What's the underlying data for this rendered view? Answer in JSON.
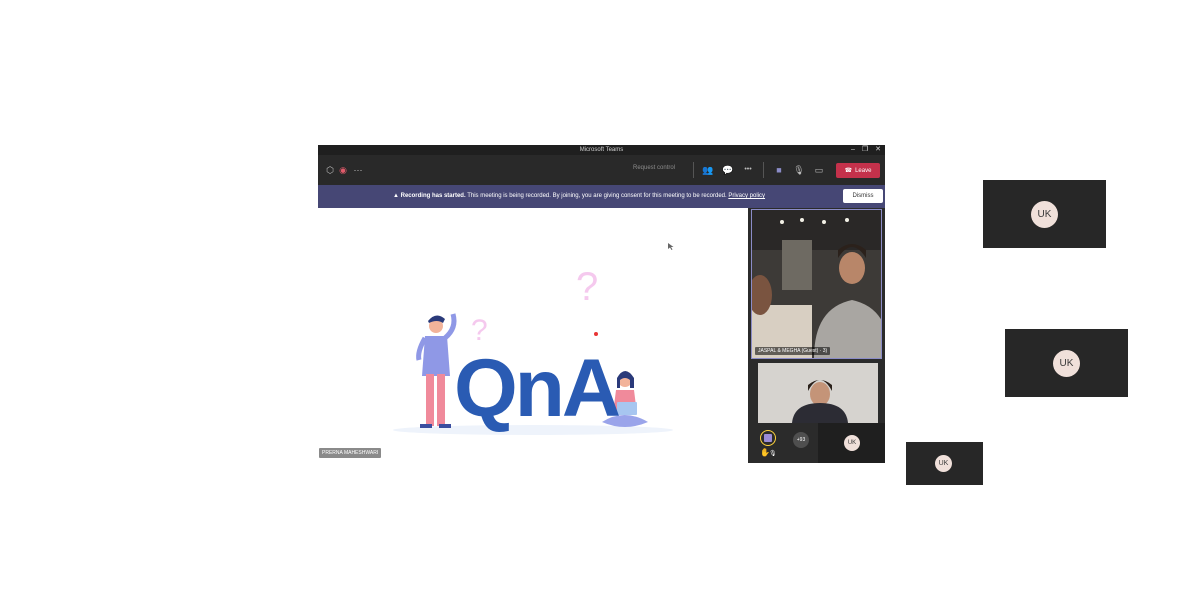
{
  "window": {
    "title": "Microsoft Teams",
    "controls": [
      "–",
      "❐",
      "✕"
    ]
  },
  "toolbar": {
    "request_control": "Request control",
    "more_label": "•••",
    "leave_label": "Leave"
  },
  "banner": {
    "bold": "Recording has started.",
    "text": " This meeting is being recorded. By joining, you are giving consent for this meeting to be recorded. ",
    "link": "Privacy policy",
    "dismiss": "Dismiss"
  },
  "stage": {
    "content": "QnA",
    "presenter": "PRERNA MAHESHWARI"
  },
  "rail": {
    "main_tile_label": "JASPAL & MEGHA (Guest) · 3)",
    "more_count": "+93",
    "uk_initials": "UK"
  },
  "external_tiles": [
    {
      "initials": "UK"
    },
    {
      "initials": "UK"
    },
    {
      "initials": "UK"
    }
  ]
}
